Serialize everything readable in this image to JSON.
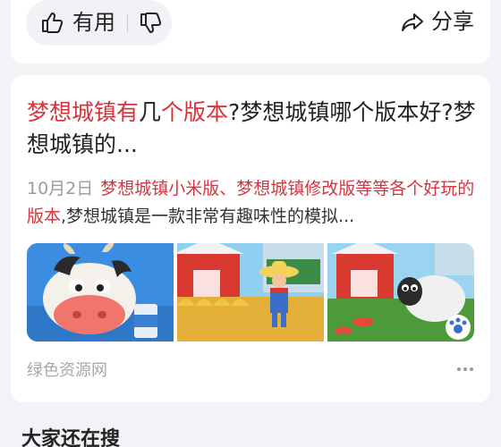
{
  "feedback": {
    "useful_label": "有用",
    "share_label": "分享"
  },
  "result": {
    "title_parts": [
      "梦想城镇有",
      "几",
      "个版本",
      "?梦想城镇哪个版本好?梦想城镇的..."
    ],
    "date": "10月2日",
    "snippet_highlight": "梦想城镇小米版、梦想城镇修改版等等各个好玩的版本",
    "snippet_rest": ",梦想城镇是一款非常有趣味性的模拟...",
    "source": "绿色资源网",
    "images": [
      "cartoon-cow-image",
      "farmer-barn-image",
      "sheep-barn-image"
    ]
  },
  "related": {
    "heading": "大家还在搜"
  },
  "colors": {
    "highlight": "#d6343c",
    "background": "#f2f3f6"
  }
}
